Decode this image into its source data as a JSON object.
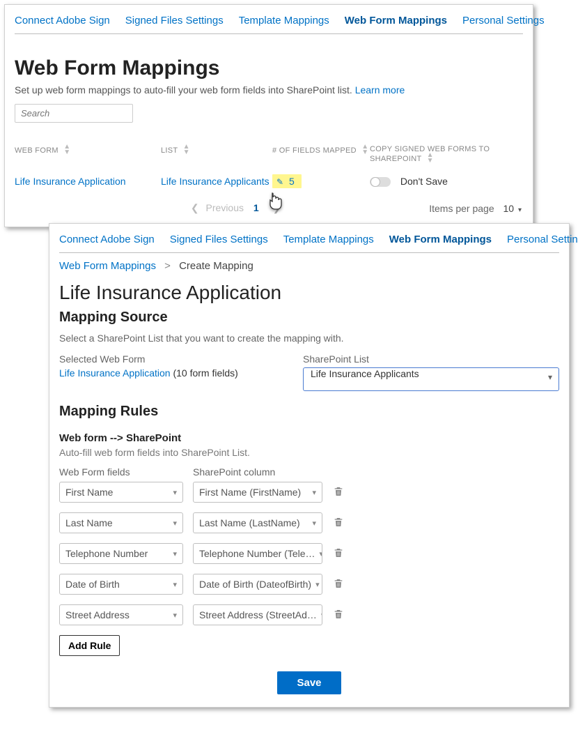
{
  "tabs": {
    "connect": "Connect Adobe Sign",
    "signed": "Signed Files Settings",
    "templates": "Template Mappings",
    "webforms": "Web Form Mappings",
    "personal": "Personal Settings"
  },
  "top": {
    "title": "Web Form Mappings",
    "description": "Set up web form mappings to auto-fill your web form fields into SharePoint list. ",
    "learn_more": "Learn more",
    "search_placeholder": "Search",
    "cols": {
      "webform": "WEB FORM",
      "list": "LIST",
      "fields": "# OF FIELDS MAPPED",
      "copy": "COPY SIGNED WEB FORMS TO SHAREPOINT"
    },
    "row": {
      "webform": "Life Insurance Application",
      "list": "Life Insurance Applicants",
      "fields": "5",
      "copy": "Don't Save"
    },
    "paging": {
      "previous": "Previous",
      "page": "1",
      "items_per_label": "Items per page",
      "items_per_value": "10"
    }
  },
  "bottom": {
    "breadcrumb_root": "Web Form Mappings",
    "breadcrumb_current": "Create Mapping",
    "title": "Life Insurance Application",
    "mapping_source_heading": "Mapping Source",
    "mapping_source_help": "Select a SharePoint List that you want to create the mapping with.",
    "selected_webform_label": "Selected Web Form",
    "selected_webform_link": "Life Insurance Application",
    "selected_webform_suffix": " (10 form fields)",
    "sp_list_label": "SharePoint List",
    "sp_list_value": "Life Insurance Applicants",
    "mapping_rules_heading": "Mapping Rules",
    "rules_subheading": "Web form --> SharePoint",
    "rules_hint": "Auto-fill web form fields into SharePoint List.",
    "col_webform_fields": "Web Form fields",
    "col_sp_column": "SharePoint column",
    "rules": [
      {
        "field": "First Name",
        "column": "First Name (FirstName)"
      },
      {
        "field": "Last Name",
        "column": "Last Name (LastName)"
      },
      {
        "field": "Telephone Number",
        "column": "Telephone Number (Tele…"
      },
      {
        "field": "Date of Birth",
        "column": "Date of Birth (DateofBirth)"
      },
      {
        "field": "Street Address",
        "column": "Street Address (StreetAd…"
      }
    ],
    "add_rule": "Add Rule",
    "save": "Save"
  }
}
